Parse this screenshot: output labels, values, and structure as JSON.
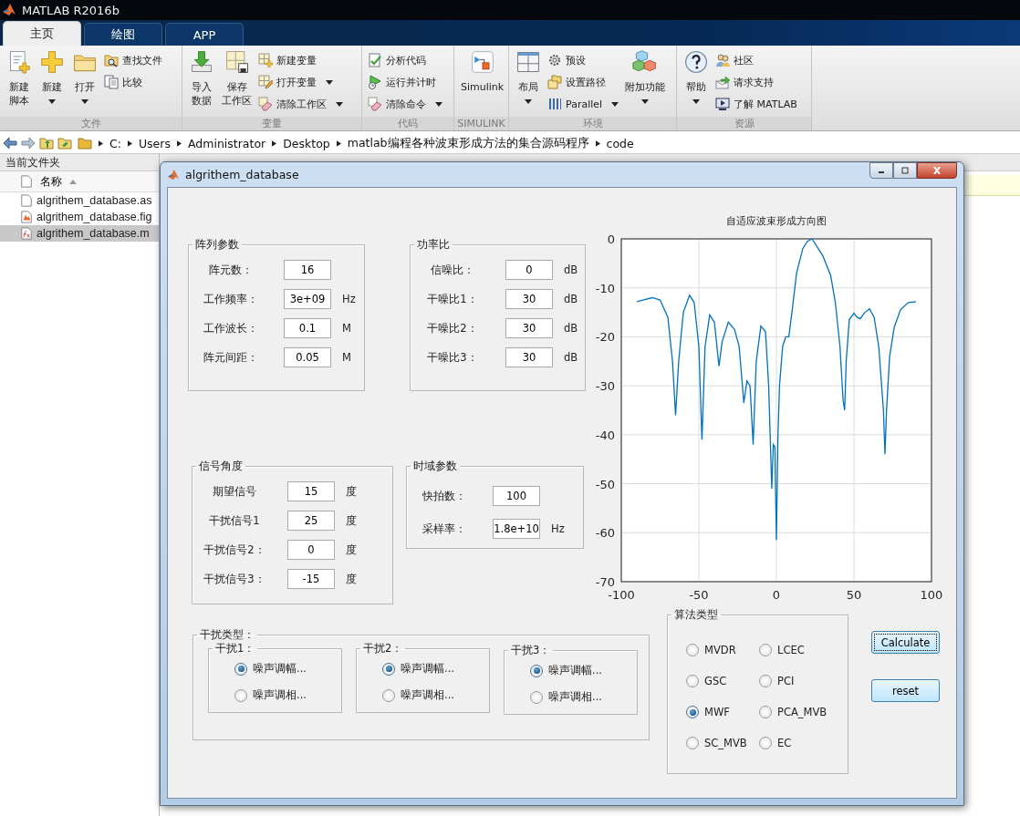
{
  "app": {
    "title": "MATLAB R2016b"
  },
  "tabs": [
    {
      "label": "主页",
      "selected": true
    },
    {
      "label": "绘图",
      "selected": false
    },
    {
      "label": "APP",
      "selected": false
    }
  ],
  "toolstrip": {
    "groups": [
      {
        "label": "文件",
        "items": [
          {
            "kind": "large",
            "lines": [
              "新建",
              "脚本"
            ],
            "caret": false
          },
          {
            "kind": "large",
            "lines": [
              "新建"
            ],
            "caret": true
          },
          {
            "kind": "large",
            "lines": [
              "打开"
            ],
            "caret": true
          },
          {
            "kind": "stack",
            "items": [
              {
                "label": "查找文件",
                "caret": false
              },
              {
                "label": "比较",
                "caret": false
              }
            ]
          }
        ]
      },
      {
        "label": "变量",
        "items": [
          {
            "kind": "large",
            "lines": [
              "导入",
              "数据"
            ],
            "caret": false
          },
          {
            "kind": "large",
            "lines": [
              "保存",
              "工作区"
            ],
            "caret": false
          },
          {
            "kind": "stack",
            "items": [
              {
                "label": "新建变量",
                "caret": false
              },
              {
                "label": "打开变量",
                "caret": true
              },
              {
                "label": "清除工作区",
                "caret": true
              }
            ]
          }
        ]
      },
      {
        "label": "代码",
        "items": [
          {
            "kind": "stack",
            "items": [
              {
                "label": "分析代码",
                "caret": false
              },
              {
                "label": "运行并计时",
                "caret": false
              },
              {
                "label": "清除命令",
                "caret": true
              }
            ]
          }
        ]
      },
      {
        "label": "SIMULINK",
        "items": [
          {
            "kind": "large",
            "lines": [
              "Simulink"
            ],
            "caret": false
          }
        ]
      },
      {
        "label": "环境",
        "items": [
          {
            "kind": "large",
            "lines": [
              "布局"
            ],
            "caret": true
          },
          {
            "kind": "stack",
            "items": [
              {
                "label": "预设",
                "caret": false
              },
              {
                "label": "设置路径",
                "caret": false
              },
              {
                "label": "Parallel",
                "caret": true
              }
            ]
          },
          {
            "kind": "large",
            "lines": [
              "附加功能"
            ],
            "caret": true
          }
        ]
      },
      {
        "label": "资源",
        "items": [
          {
            "kind": "large",
            "lines": [
              "帮助"
            ],
            "caret": true
          },
          {
            "kind": "stack",
            "items": [
              {
                "label": "社区",
                "caret": false
              },
              {
                "label": "请求支持",
                "caret": false
              },
              {
                "label": "了解 MATLAB",
                "caret": false
              }
            ]
          }
        ]
      }
    ]
  },
  "address": {
    "path": [
      "C:",
      "Users",
      "Administrator",
      "Desktop",
      "matlab编程各种波束形成方法的集合源码程序",
      "code"
    ]
  },
  "file_browser": {
    "title": "当前文件夹",
    "column": "名称",
    "files": [
      {
        "name": "algrithem_database.as",
        "kind": "document",
        "selected": false
      },
      {
        "name": "algrithem_database.fig",
        "kind": "figure",
        "selected": false
      },
      {
        "name": "algrithem_database.m",
        "kind": "script",
        "selected": true
      }
    ]
  },
  "figure": {
    "title": "algrithem_database",
    "panels": [
      {
        "title": "阵列参数",
        "fields": [
          {
            "label": "阵元数：",
            "value": "16"
          },
          {
            "label": "工作频率：",
            "value": "3e+09",
            "unit": "Hz"
          },
          {
            "label": "工作波长：",
            "value": "0.1",
            "unit": "M"
          },
          {
            "label": "阵元间距：",
            "value": "0.05",
            "unit": "M"
          }
        ]
      },
      {
        "title": "功率比",
        "fields": [
          {
            "label": "信噪比：",
            "value": "0",
            "unit": "dB"
          },
          {
            "label": "干噪比1：",
            "value": "30",
            "unit": "dB"
          },
          {
            "label": "干噪比2：",
            "value": "30",
            "unit": "dB"
          },
          {
            "label": "干噪比3：",
            "value": "30",
            "unit": "dB"
          }
        ]
      },
      {
        "title": "信号角度",
        "fields": [
          {
            "label": "期望信号",
            "value": "15",
            "unit": "度"
          },
          {
            "label": "干扰信号1",
            "value": "25",
            "unit": "度"
          },
          {
            "label": "干扰信号2：",
            "value": "0",
            "unit": "度"
          },
          {
            "label": "干扰信号3：",
            "value": "-15",
            "unit": "度"
          }
        ]
      },
      {
        "title": "时域参数",
        "fields": [
          {
            "label": "快拍数：",
            "value": "100"
          },
          {
            "label": "采样率：",
            "value": "1.8e+10",
            "unit": "Hz"
          }
        ]
      }
    ],
    "interference": {
      "title": "干扰类型：",
      "groups": [
        {
          "title": "干扰1：",
          "options": [
            {
              "label": "噪声调幅...",
              "selected": true
            },
            {
              "label": "噪声调相...",
              "selected": false
            }
          ]
        },
        {
          "title": "干扰2：",
          "options": [
            {
              "label": "噪声调幅...",
              "selected": true
            },
            {
              "label": "噪声调相...",
              "selected": false
            }
          ]
        },
        {
          "title": "干扰3：",
          "options": [
            {
              "label": "噪声调幅...",
              "selected": true
            },
            {
              "label": "噪声调相...",
              "selected": false
            }
          ]
        }
      ]
    },
    "algorithm": {
      "title": "算法类型",
      "options": [
        {
          "label": "MVDR",
          "selected": false
        },
        {
          "label": "LCEC",
          "selected": false
        },
        {
          "label": "GSC",
          "selected": false
        },
        {
          "label": "PCI",
          "selected": false
        },
        {
          "label": "MWF",
          "selected": true
        },
        {
          "label": "PCA_MVB",
          "selected": false
        },
        {
          "label": "SC_MVB",
          "selected": false
        },
        {
          "label": "EC",
          "selected": false
        }
      ]
    },
    "buttons": [
      {
        "label": "Calculate",
        "focused": true
      },
      {
        "label": "reset",
        "focused": false
      }
    ],
    "chart_data": {
      "type": "line",
      "title": "自适应波束形成方向图",
      "x": [
        -90,
        -85,
        -80,
        -75,
        -70,
        -67,
        -65,
        -63,
        -60,
        -56,
        -53,
        -50,
        -48,
        -46,
        -43,
        -40,
        -37,
        -35,
        -31,
        -27,
        -24,
        -21,
        -19,
        -17,
        -15,
        -13,
        -10,
        -7,
        -5,
        -3,
        -2,
        -1,
        0,
        1,
        2,
        4,
        6,
        8,
        10,
        13,
        17,
        20,
        23,
        26,
        30,
        35,
        38,
        41,
        43,
        44,
        45,
        47,
        50,
        52,
        54,
        57,
        60,
        63,
        66,
        69,
        70,
        71,
        73,
        76,
        80,
        85,
        90
      ],
      "series": [
        {
          "color": "#0072bd",
          "values": [
            -12.8,
            -12.4,
            -12.0,
            -12.5,
            -16,
            -25,
            -36,
            -25,
            -15,
            -11.5,
            -13,
            -22,
            -41,
            -22,
            -15.5,
            -17,
            -26,
            -21,
            -17,
            -18.5,
            -22,
            -33.5,
            -29,
            -30,
            -42,
            -25,
            -17.8,
            -19,
            -30,
            -51,
            -42,
            -42.5,
            -61.5,
            -40,
            -30,
            -22,
            -20,
            -20,
            -15,
            -7,
            -2,
            -0.5,
            0,
            -1.5,
            -3.5,
            -7.5,
            -13,
            -22,
            -33,
            -35,
            -25,
            -16.5,
            -15.2,
            -16,
            -16.3,
            -15,
            -14.3,
            -16,
            -22,
            -35,
            -44,
            -35,
            -24,
            -18,
            -14.5,
            -13,
            -12.8
          ]
        }
      ],
      "grid": true,
      "xlim": [
        -100,
        100
      ],
      "ylim": [
        -70,
        0
      ],
      "xticks": [
        -100,
        -50,
        0,
        50,
        100
      ],
      "yticks": [
        -70,
        -60,
        -50,
        -40,
        -30,
        -20,
        -10,
        0
      ]
    }
  }
}
